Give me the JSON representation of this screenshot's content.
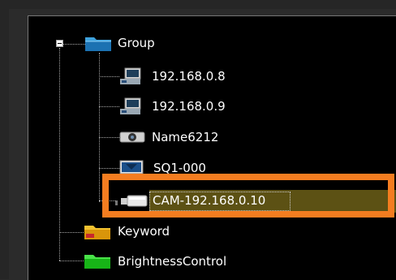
{
  "tree": {
    "group": {
      "label": "Group",
      "icon": "folder-icon",
      "color": "#1f7fbf"
    },
    "children": [
      {
        "label": "192.168.0.8",
        "icon": "camera-monitor-icon"
      },
      {
        "label": "192.168.0.9",
        "icon": "camera-monitor-icon"
      },
      {
        "label": "Name6212",
        "icon": "dome-camera-icon"
      },
      {
        "label": "SQ1-000",
        "icon": "monitor-icon"
      },
      {
        "label": "CAM-192.168.0.10",
        "icon": "bullet-camera-icon",
        "selected": true
      }
    ],
    "keyword": {
      "label": "Keyword",
      "icon": "folder-icon",
      "color": "#e8a20c"
    },
    "brightness": {
      "label": "BrightnessControl",
      "icon": "folder-icon",
      "color": "#1bc41b"
    }
  },
  "colors": {
    "highlight": "#f47d20",
    "selection": "#5c5114"
  }
}
